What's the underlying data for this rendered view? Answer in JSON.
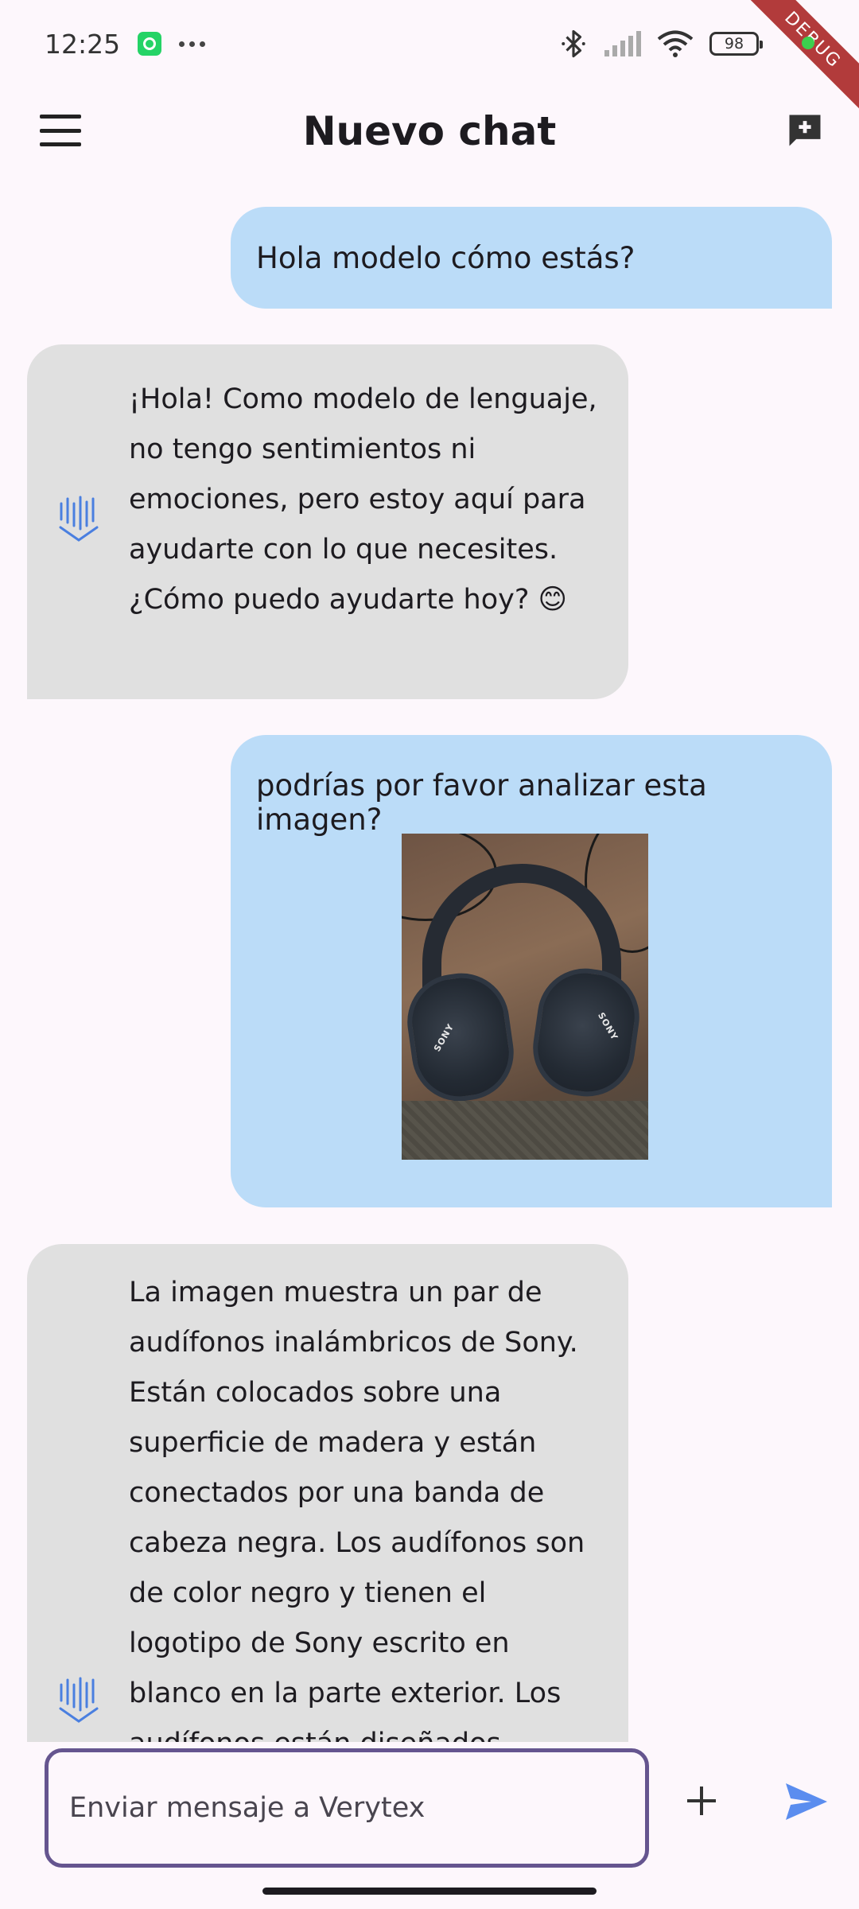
{
  "status_bar": {
    "time": "12:25",
    "battery_level": "98",
    "debug_label": "DEBUG"
  },
  "app_bar": {
    "title": "Nuevo chat"
  },
  "messages": [
    {
      "role": "user",
      "text": "Hola modelo cómo estás?"
    },
    {
      "role": "assistant",
      "text": "¡Hola! Como modelo de lenguaje, no tengo sentimientos ni emociones, pero estoy aquí para ayudarte con lo que necesites. ¿Cómo puedo ayudarte hoy? 😊"
    },
    {
      "role": "user",
      "text": "podrías por favor analizar esta imagen?",
      "image": {
        "brand_text": "SONY"
      }
    },
    {
      "role": "assistant",
      "text": "La imagen muestra un par de audífonos inalámbricos de Sony. Están colocados sobre una superficie de madera y están conectados por una banda de cabeza negra. Los audífonos son de color negro y tienen el logotipo de Sony escrito en blanco en la parte exterior. Los audífonos están diseñados"
    }
  ],
  "composer": {
    "placeholder": "Enviar mensaje a Verytex"
  },
  "colors": {
    "user_bubble": "#bbdcf8",
    "assistant_bubble": "#e0e0e0",
    "accent": "#65558f",
    "send_icon": "#5b8def",
    "bot_icon": "#4a7fe0"
  }
}
